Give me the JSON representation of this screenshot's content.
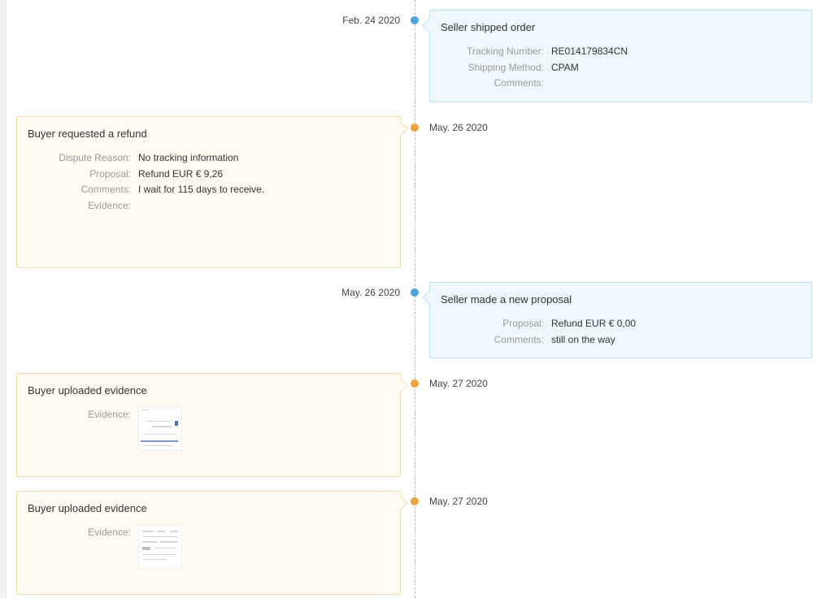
{
  "events": [
    {
      "side": "seller",
      "date": "Feb. 24 2020",
      "title": "Seller shipped order",
      "fields": [
        {
          "label": "Tracking Number:",
          "value": "RE014179834CN"
        },
        {
          "label": "Shipping Method:",
          "value": "CPAM"
        },
        {
          "label": "Comments:",
          "value": ""
        }
      ]
    },
    {
      "side": "buyer",
      "date": "May. 26 2020",
      "title": "Buyer requested a refund",
      "fields": [
        {
          "label": "Dispute Reason:",
          "value": "No tracking information"
        },
        {
          "label": "Proposal:",
          "value": "Refund EUR € 9,26"
        },
        {
          "label": "Comments:",
          "value": "I wait for 115 days to receive."
        },
        {
          "label": "Evidence:",
          "value": ""
        }
      ]
    },
    {
      "side": "seller",
      "date": "May. 26 2020",
      "title": "Seller made a new proposal",
      "fields": [
        {
          "label": "Proposal:",
          "value": "Refund EUR € 0,00"
        },
        {
          "label": "Comments:",
          "value": "still on the way"
        }
      ]
    },
    {
      "side": "buyer",
      "date": "May. 27 2020",
      "title": "Buyer uploaded evidence",
      "fields": [
        {
          "label": "Evidence:",
          "value": ""
        }
      ]
    },
    {
      "side": "buyer",
      "date": "May. 27 2020",
      "title": "Buyer uploaded evidence",
      "fields": [
        {
          "label": "Evidence:",
          "value": ""
        }
      ]
    }
  ],
  "colors": {
    "seller_bg": "#eef8fd",
    "seller_border": "#bfe2f1",
    "buyer_bg": "#fffbf3",
    "buyer_border": "#f6dcae",
    "seller_dot": "#4aa3df",
    "buyer_dot": "#f1a33b"
  }
}
